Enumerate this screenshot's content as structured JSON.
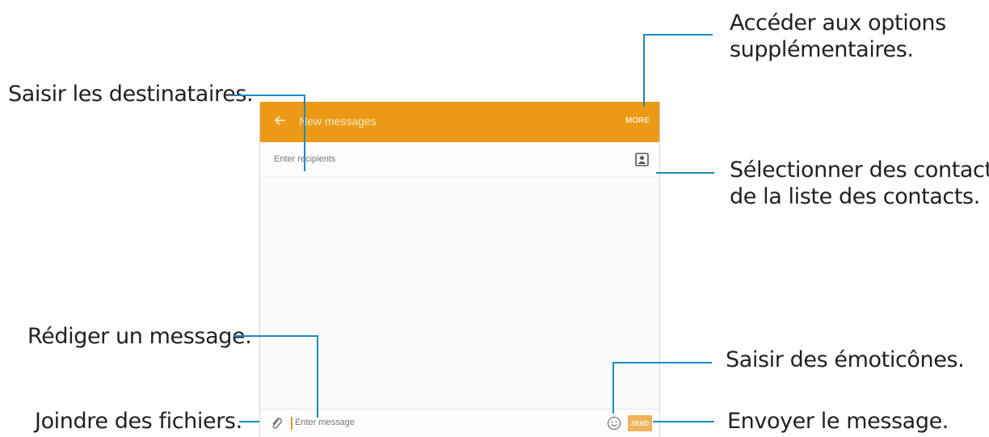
{
  "screen": {
    "title": "New messages",
    "more_label": "MORE",
    "recipients_placeholder": "Enter recipients",
    "message_placeholder": "Enter message",
    "send_label": "SEND",
    "icons": [
      "back-arrow-icon",
      "contact-icon",
      "attach-icon",
      "emoji-icon"
    ],
    "accent_color": "#ec9a16"
  },
  "callouts": {
    "more_options": [
      "Accéder aux options",
      "supplémentaires."
    ],
    "recipients": "Saisir les destinataires.",
    "contacts": [
      "Sélectionner des contacts",
      "de la liste des contacts."
    ],
    "compose": "Rédiger un message.",
    "emoticons": "Saisir des émoticônes.",
    "attach": "Joindre des fichiers.",
    "send": "Envoyer le message."
  }
}
